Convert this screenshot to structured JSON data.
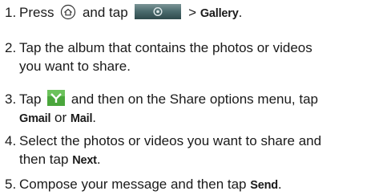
{
  "steps": [
    {
      "number": "1.",
      "parts": {
        "press": "Press",
        "and_tap": "and tap",
        "arrow": ">",
        "gallery": "Gallery",
        "period": "."
      },
      "icons": [
        "home-button-icon",
        "camera-gallery-button-icon"
      ]
    },
    {
      "number": "2.",
      "line1": "Tap the album that contains the photos or videos",
      "line2": "you want to share."
    },
    {
      "number": "3.",
      "parts": {
        "tap": "Tap",
        "rest": "and then on the Share options menu, tap",
        "gmail": "Gmail",
        "or": "or",
        "mail": "Mail",
        "period": "."
      },
      "icons": [
        "share-menu-icon"
      ]
    },
    {
      "number": "4.",
      "line1": "Select the photos or videos you want to share and",
      "line2_prefix": "then tap",
      "next": "Next",
      "period": "."
    },
    {
      "number": "5.",
      "prefix": "Compose your message and then tap",
      "send": "Send",
      "period": "."
    }
  ],
  "colors": {
    "text": "#1a1a1a",
    "camera_button": "#4a6a6c",
    "share_icon": "#4aa63c"
  }
}
